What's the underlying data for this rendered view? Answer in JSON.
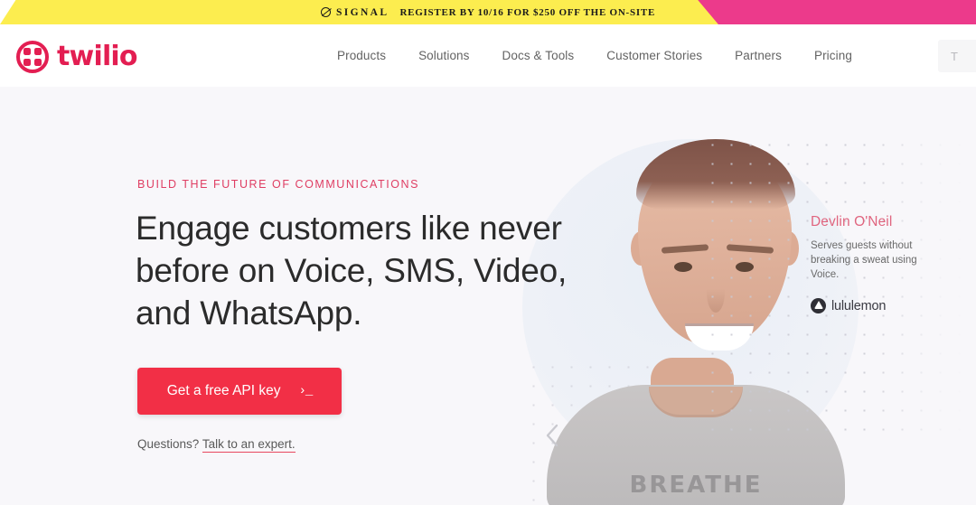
{
  "promo": {
    "brand": "SIGNAL",
    "brand_icon": "signal-slash-icon",
    "offer": "REGISTER BY 10/16 FOR $250 OFF THE ON-SITE",
    "yellow": "#fced4f",
    "pink": "#ec3a8b"
  },
  "header": {
    "logo_text": "twilio",
    "logo_icon": "twilio-logo-icon",
    "brand_color": "#e31e52",
    "nav": [
      {
        "label": "Products"
      },
      {
        "label": "Solutions"
      },
      {
        "label": "Docs & Tools"
      },
      {
        "label": "Customer Stories"
      },
      {
        "label": "Partners"
      },
      {
        "label": "Pricing"
      }
    ],
    "search": {
      "value": "T",
      "placeholder": "T"
    }
  },
  "hero": {
    "eyebrow": "BUILD THE FUTURE OF COMMUNICATIONS",
    "eyebrow_color": "#df3e63",
    "headline": "Engage customers like never before on Voice, SMS, Video, and WhatsApp.",
    "cta": {
      "label": "Get a free API key",
      "prompt": "›_",
      "bg": "#f22f46"
    },
    "questions_prefix": "Questions? ",
    "questions_link": "Talk to an expert.",
    "link_underline_color": "#e8485f",
    "background": "#f8f7fa"
  },
  "carousel": {
    "prev_icon": "chevron-left-icon"
  },
  "testimonial": {
    "name": "Devlin O'Neil",
    "name_color": "#e0657f",
    "quote": "Serves guests without breaking a sweat using Voice.",
    "brand": "lululemon",
    "brand_icon": "lululemon-logo-icon"
  },
  "person": {
    "shirt_print": "BREATHE"
  }
}
